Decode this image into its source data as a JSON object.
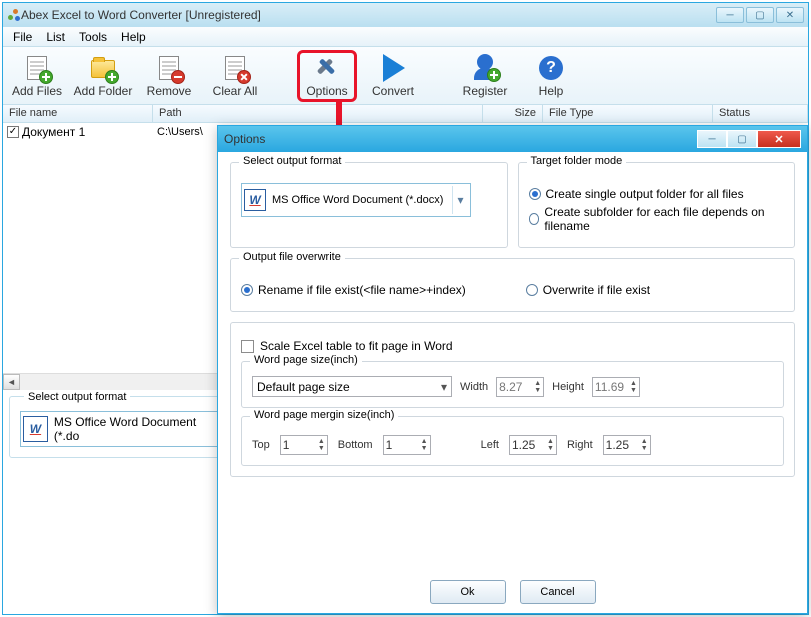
{
  "main": {
    "title": "Abex Excel to Word Converter [Unregistered]",
    "menu": [
      "File",
      "List",
      "Tools",
      "Help"
    ],
    "toolbar": [
      {
        "label": "Add Files"
      },
      {
        "label": "Add Folder"
      },
      {
        "label": "Remove"
      },
      {
        "label": "Clear All"
      },
      {
        "label": "Options"
      },
      {
        "label": "Convert"
      },
      {
        "label": "Register"
      },
      {
        "label": "Help"
      }
    ],
    "columns": {
      "filename": "File name",
      "path": "Path",
      "size": "Size",
      "filetype": "File Type",
      "status": "Status"
    },
    "rows": [
      {
        "checked": true,
        "filename": "Документ 1",
        "path": "C:\\Users\\"
      }
    ],
    "outputGroup": {
      "label": "Select output format",
      "value": "MS Office Word Document (*.do"
    }
  },
  "dialog": {
    "title": "Options",
    "outputFormat": {
      "label": "Select output format",
      "value": "MS Office Word Document (*.docx)"
    },
    "targetFolder": {
      "label": "Target folder mode",
      "opt1": "Create single output folder for all files",
      "opt2": "Create subfolder for each file depends on filename",
      "selected": 1
    },
    "overwrite": {
      "label": "Output file overwrite",
      "opt1": "Rename if file exist(<file name>+index)",
      "opt2": "Overwrite if file exist",
      "selected": 1
    },
    "scaleLabel": "Scale Excel table to fit page in Word",
    "pageSize": {
      "label": "Word page size(inch)",
      "select": "Default page size",
      "widthLabel": "Width",
      "width": "8.27",
      "heightLabel": "Height",
      "height": "11.69"
    },
    "margins": {
      "label": "Word page mergin size(inch)",
      "topLabel": "Top",
      "top": "1",
      "bottomLabel": "Bottom",
      "bottom": "1",
      "leftLabel": "Left",
      "left": "1.25",
      "rightLabel": "Right",
      "right": "1.25"
    },
    "ok": "Ok",
    "cancel": "Cancel"
  }
}
